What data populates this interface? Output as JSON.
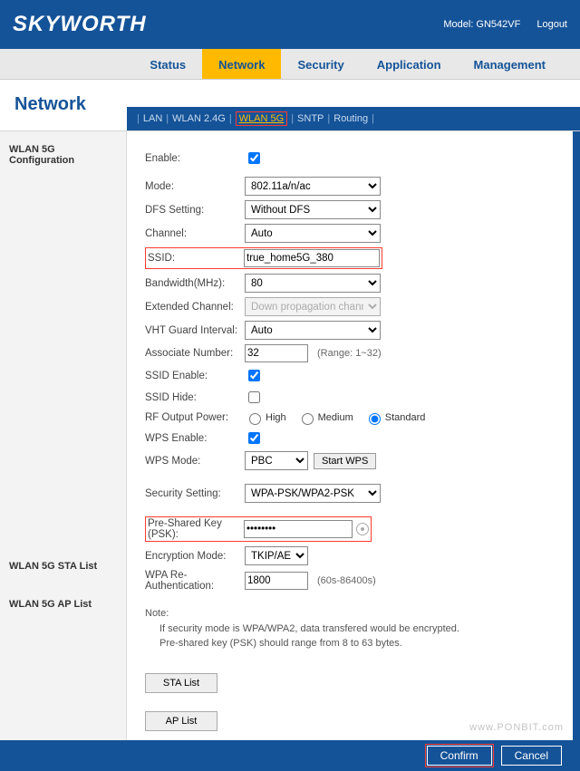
{
  "header": {
    "brand": "SKYWORTH",
    "model_label": "Model: GN542VF",
    "logout": "Logout"
  },
  "nav": {
    "items": [
      "Status",
      "Network",
      "Security",
      "Application",
      "Management"
    ],
    "active": "Network"
  },
  "page_title": "Network",
  "subnav": {
    "items": [
      "LAN",
      "WLAN 2.4G",
      "WLAN 5G",
      "SNTP",
      "Routing"
    ],
    "active": "WLAN 5G"
  },
  "sidebar": {
    "items": [
      "WLAN 5G Configuration",
      "WLAN 5G STA List",
      "WLAN 5G AP List"
    ]
  },
  "form": {
    "enable_label": "Enable:",
    "enable_checked": true,
    "mode_label": "Mode:",
    "mode_value": "802.11a/n/ac",
    "dfs_label": "DFS Setting:",
    "dfs_value": "Without DFS",
    "channel_label": "Channel:",
    "channel_value": "Auto",
    "ssid_label": "SSID:",
    "ssid_value": "true_home5G_380",
    "bw_label": "Bandwidth(MHz):",
    "bw_value": "80",
    "extch_label": "Extended Channel:",
    "extch_value": "Down propagation channel",
    "vht_label": "VHT Guard Interval:",
    "vht_value": "Auto",
    "assoc_label": "Associate Number:",
    "assoc_value": "32",
    "assoc_range": "(Range: 1~32)",
    "ssid_en_label": "SSID Enable:",
    "ssid_en_checked": true,
    "ssid_hide_label": "SSID Hide:",
    "ssid_hide_checked": false,
    "rf_label": "RF Output Power:",
    "rf_options": [
      "High",
      "Medium",
      "Standard"
    ],
    "rf_selected": "Standard",
    "wps_en_label": "WPS Enable:",
    "wps_en_checked": true,
    "wps_mode_label": "WPS Mode:",
    "wps_mode_value": "PBC",
    "wps_btn": "Start WPS",
    "sec_label": "Security Setting:",
    "sec_value": "WPA-PSK/WPA2-PSK",
    "psk_label": "Pre-Shared Key (PSK):",
    "psk_value": "••••••••",
    "enc_label": "Encryption Mode:",
    "enc_value": "TKIP/AES",
    "reauth_label": "WPA Re-Authentication:",
    "reauth_value": "1800",
    "reauth_range": "(60s-86400s)",
    "note_title": "Note:",
    "note_line1": "If security mode is WPA/WPA2, data transfered would be encrypted.",
    "note_line2": "Pre-shared key (PSK) should range from 8 to 63 bytes.",
    "sta_btn": "STA List",
    "ap_btn": "AP List"
  },
  "footer": {
    "confirm": "Confirm",
    "cancel": "Cancel",
    "watermark": "www.PONBIT.com"
  }
}
